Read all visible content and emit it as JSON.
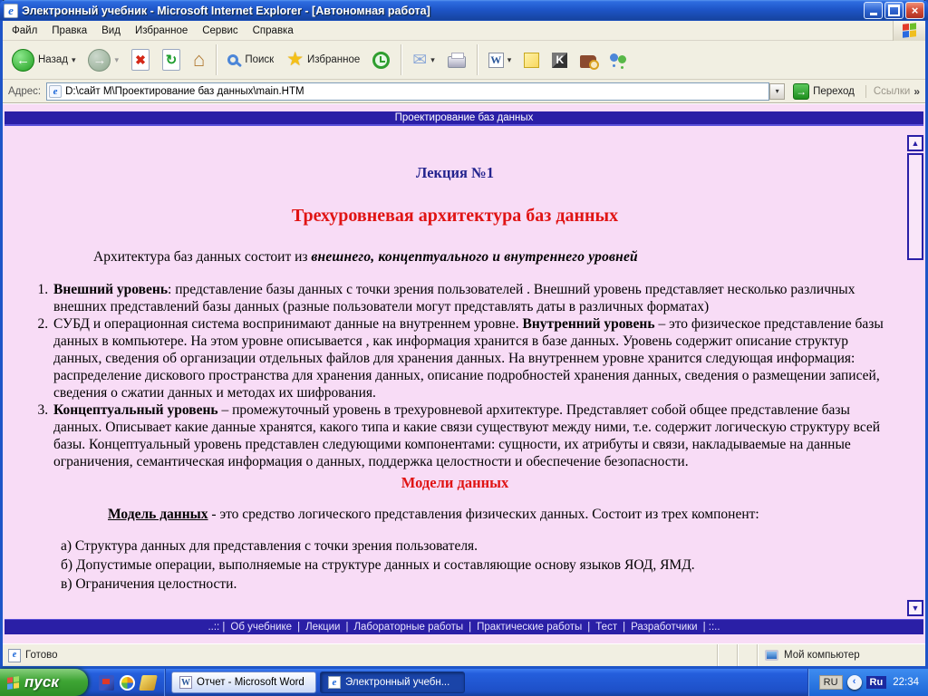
{
  "window": {
    "title": "Электронный учебник - Microsoft Internet Explorer - [Автономная работа]",
    "app_icon_glyph": "e"
  },
  "menu": {
    "items": [
      "Файл",
      "Правка",
      "Вид",
      "Избранное",
      "Сервис",
      "Справка"
    ]
  },
  "toolbar": {
    "back_label": "Назад",
    "search_label": "Поиск",
    "favorites_label": "Избранное"
  },
  "address": {
    "label": "Адрес:",
    "value": "D:\\сайт М\\Проектирование баз данных\\main.HTM",
    "go_label": "Переход",
    "links_label": "Ссылки"
  },
  "icons": {
    "back_arrow": "←",
    "forward_arrow": "→",
    "stop": "✖",
    "refresh": "↻",
    "home": "⌂",
    "mail": "✉",
    "star": "★",
    "dropdown": "▾",
    "go_arrow": "→",
    "chevrons": "»",
    "word_letter": "W",
    "kaspersky_letter": "K",
    "ie_letter": "e",
    "scroll_up": "▲",
    "scroll_down": "▼",
    "tray_chevron": "‹",
    "close": "×"
  },
  "page": {
    "banner": "Проектирование баз данных",
    "lecture": "Лекция №1",
    "title": "Трехуровневая архитектура баз данных",
    "intro": {
      "normal": "Архитектура баз данных состоит из ",
      "emphasis": "внешнего, концептуального и внутреннего уровней"
    },
    "list": [
      {
        "pre": "",
        "term": "Внешний уровень",
        "text": ": представление базы данных с точки зрения пользователей . Внешний уровень представляет несколько различных внешних представлений базы данных (разные пользователи могут представлять даты в различных форматах)"
      },
      {
        "pre": "СУБД и операционная система воспринимают данные на внутреннем уровне. ",
        "term": "Внутренний уровень",
        "text": " – это физическое представление базы данных в компьютере. На этом уровне описывается , как информация хранится в базе данных. Уровень содержит описание структур данных, сведения об организации отдельных файлов для хранения данных. На внутреннем уровне хранится следующая информация: распределение дискового пространства для хранения данных, описание подробностей хранения данных, сведения о размещении записей, сведения о сжатии данных и методах их шифрования."
      },
      {
        "pre": "",
        "term": "Концептуальный уровень",
        "text": " – промежуточный уровень в трехуровневой архитектуре. Представляет собой общее представление базы данных. Описывает какие данные хранятся, какого типа и какие связи существуют между ними, т.е. содержит логическую структуру всей базы. Концептуальный уровень представлен следующими компонентами: сущности, их атрибуты и связи, накладываемые на данные ограничения, семантическая информация о данных, поддержка целостности и обеспечение безопасности."
      }
    ],
    "models_heading": "Модели данных",
    "model": {
      "term": "Модель данных",
      "definition": " - это средство логического представления физических данных. Состоит из трех компонент:"
    },
    "components": [
      "а) Структура данных для представления с точки зрения пользователя.",
      "б) Допустимые операции, выполняемые на структуре данных и составляющие основу языков ЯОД, ЯМД.",
      "в) Ограничения целостности."
    ],
    "footer": {
      "prefix": "..:: |",
      "links": [
        "Об учебнике",
        "Лекции",
        "Лабораторные работы",
        "Практические работы",
        "Тест",
        "Разработчики"
      ],
      "sep": "|",
      "suffix": "| ::.."
    }
  },
  "statusbar": {
    "status": "Готово",
    "zone": "Мой компьютер"
  },
  "taskbar": {
    "start_label": "пуск",
    "tasks": [
      {
        "label": "Отчет - Microsoft Word"
      },
      {
        "label": "Электронный учебн..."
      }
    ],
    "tray": {
      "lang": "RU",
      "lang_badge": "Ru",
      "time": "22:34"
    }
  },
  "colors": {
    "accent_navy": "#2A1FA6",
    "page_pink": "#F8DCF6",
    "heading_red": "#E01414",
    "lecture_blue": "#24248E",
    "taskbar_blue": "#245EDC",
    "start_green": "#3EA534"
  }
}
